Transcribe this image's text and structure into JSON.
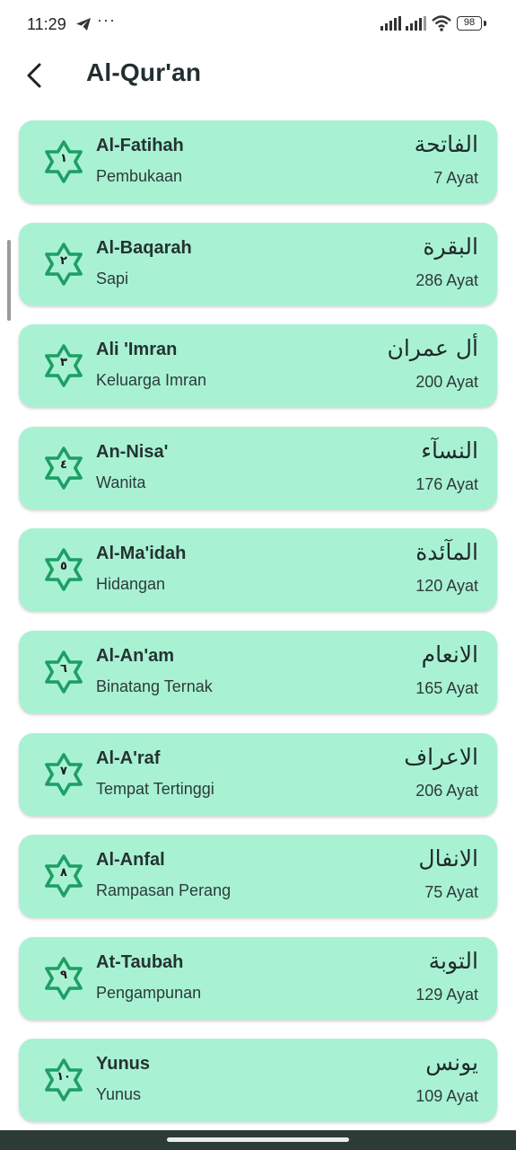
{
  "status_bar": {
    "time": "11:29",
    "more": "···",
    "battery": "98"
  },
  "header": {
    "title": "Al-Qur'an"
  },
  "colors": {
    "card_bg": "#a8f2d3",
    "badge_stroke": "#1e9e66"
  },
  "icons": {
    "back": "back-arrow-icon",
    "badge": "star-badge-icon"
  },
  "surahs": [
    {
      "number": "١",
      "latin": "Al-Fatihah",
      "meaning": "Pembukaan",
      "arabic": "الفاتحة",
      "ayat": "7 Ayat"
    },
    {
      "number": "٢",
      "latin": "Al-Baqarah",
      "meaning": "Sapi",
      "arabic": "البقرة",
      "ayat": "286 Ayat"
    },
    {
      "number": "٣",
      "latin": "Ali 'Imran",
      "meaning": "Keluarga Imran",
      "arabic": "أل عمران",
      "ayat": "200 Ayat"
    },
    {
      "number": "٤",
      "latin": "An-Nisa'",
      "meaning": "Wanita",
      "arabic": "النسآء",
      "ayat": "176 Ayat"
    },
    {
      "number": "٥",
      "latin": "Al-Ma'idah",
      "meaning": "Hidangan",
      "arabic": "المآئدة",
      "ayat": "120 Ayat"
    },
    {
      "number": "٦",
      "latin": "Al-An'am",
      "meaning": "Binatang Ternak",
      "arabic": "الانعام",
      "ayat": "165 Ayat"
    },
    {
      "number": "٧",
      "latin": "Al-A'raf",
      "meaning": "Tempat Tertinggi",
      "arabic": "الاعراف",
      "ayat": "206 Ayat"
    },
    {
      "number": "٨",
      "latin": "Al-Anfal",
      "meaning": "Rampasan Perang",
      "arabic": "الانفال",
      "ayat": "75 Ayat"
    },
    {
      "number": "٩",
      "latin": "At-Taubah",
      "meaning": "Pengampunan",
      "arabic": "التوبة",
      "ayat": "129 Ayat"
    },
    {
      "number": "١٠",
      "latin": "Yunus",
      "meaning": "Yunus",
      "arabic": "يونس",
      "ayat": "109 Ayat"
    }
  ]
}
